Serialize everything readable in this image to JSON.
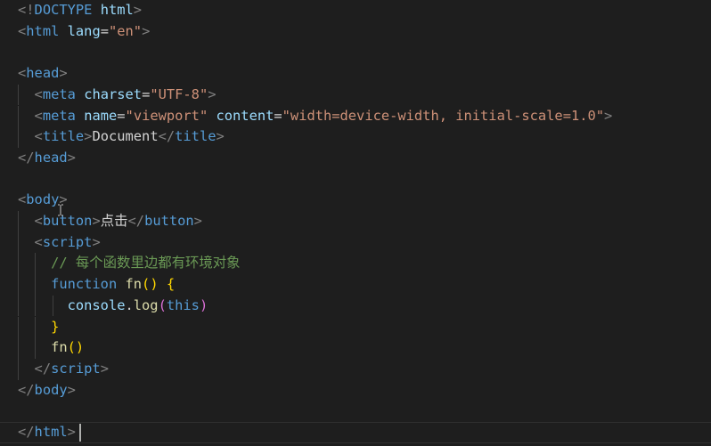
{
  "editor": {
    "lines": [
      [
        {
          "c": "t-punc",
          "t": "<!"
        },
        {
          "c": "t-tag",
          "t": "DOCTYPE"
        },
        {
          "c": "t-text",
          "t": " "
        },
        {
          "c": "t-attr",
          "t": "html"
        },
        {
          "c": "t-punc",
          "t": ">"
        }
      ],
      [
        {
          "c": "t-punc",
          "t": "<"
        },
        {
          "c": "t-tag",
          "t": "html"
        },
        {
          "c": "t-text",
          "t": " "
        },
        {
          "c": "t-attr",
          "t": "lang"
        },
        {
          "c": "t-text",
          "t": "="
        },
        {
          "c": "t-str",
          "t": "\"en\""
        },
        {
          "c": "t-punc",
          "t": ">"
        }
      ],
      [],
      [
        {
          "c": "t-punc",
          "t": "<"
        },
        {
          "c": "t-tag",
          "t": "head"
        },
        {
          "c": "t-punc",
          "t": ">"
        }
      ],
      [
        {
          "c": "t-text",
          "t": "  "
        },
        {
          "c": "t-punc",
          "t": "<"
        },
        {
          "c": "t-tag",
          "t": "meta"
        },
        {
          "c": "t-text",
          "t": " "
        },
        {
          "c": "t-attr",
          "t": "charset"
        },
        {
          "c": "t-text",
          "t": "="
        },
        {
          "c": "t-str",
          "t": "\"UTF-8\""
        },
        {
          "c": "t-punc",
          "t": ">"
        }
      ],
      [
        {
          "c": "t-text",
          "t": "  "
        },
        {
          "c": "t-punc",
          "t": "<"
        },
        {
          "c": "t-tag",
          "t": "meta"
        },
        {
          "c": "t-text",
          "t": " "
        },
        {
          "c": "t-attr",
          "t": "name"
        },
        {
          "c": "t-text",
          "t": "="
        },
        {
          "c": "t-str",
          "t": "\"viewport\""
        },
        {
          "c": "t-text",
          "t": " "
        },
        {
          "c": "t-attr",
          "t": "content"
        },
        {
          "c": "t-text",
          "t": "="
        },
        {
          "c": "t-str",
          "t": "\"width=device-width, initial-scale=1.0\""
        },
        {
          "c": "t-punc",
          "t": ">"
        }
      ],
      [
        {
          "c": "t-text",
          "t": "  "
        },
        {
          "c": "t-punc",
          "t": "<"
        },
        {
          "c": "t-tag",
          "t": "title"
        },
        {
          "c": "t-punc",
          "t": ">"
        },
        {
          "c": "t-text",
          "t": "Document"
        },
        {
          "c": "t-punc",
          "t": "</"
        },
        {
          "c": "t-tag",
          "t": "title"
        },
        {
          "c": "t-punc",
          "t": ">"
        }
      ],
      [
        {
          "c": "t-punc",
          "t": "</"
        },
        {
          "c": "t-tag",
          "t": "head"
        },
        {
          "c": "t-punc",
          "t": ">"
        }
      ],
      [],
      [
        {
          "c": "t-punc",
          "t": "<"
        },
        {
          "c": "t-tag",
          "t": "body"
        },
        {
          "c": "t-punc",
          "t": ">"
        }
      ],
      [
        {
          "c": "t-text",
          "t": "  "
        },
        {
          "c": "t-punc",
          "t": "<"
        },
        {
          "c": "t-tag",
          "t": "button"
        },
        {
          "c": "t-punc",
          "t": ">"
        },
        {
          "c": "t-text",
          "t": "点击"
        },
        {
          "c": "t-punc",
          "t": "</"
        },
        {
          "c": "t-tag",
          "t": "button"
        },
        {
          "c": "t-punc",
          "t": ">"
        }
      ],
      [
        {
          "c": "t-text",
          "t": "  "
        },
        {
          "c": "t-punc",
          "t": "<"
        },
        {
          "c": "t-tag",
          "t": "script"
        },
        {
          "c": "t-punc",
          "t": ">"
        }
      ],
      [
        {
          "c": "t-text",
          "t": "    "
        },
        {
          "c": "t-cmt",
          "t": "// 每个函数里边都有环境对象"
        }
      ],
      [
        {
          "c": "t-text",
          "t": "    "
        },
        {
          "c": "t-kw",
          "t": "function"
        },
        {
          "c": "t-text",
          "t": " "
        },
        {
          "c": "t-fn",
          "t": "fn"
        },
        {
          "c": "t-br1",
          "t": "()"
        },
        {
          "c": "t-text",
          "t": " "
        },
        {
          "c": "t-br1",
          "t": "{"
        }
      ],
      [
        {
          "c": "t-text",
          "t": "      "
        },
        {
          "c": "t-var",
          "t": "console"
        },
        {
          "c": "t-text",
          "t": "."
        },
        {
          "c": "t-fn",
          "t": "log"
        },
        {
          "c": "t-br2",
          "t": "("
        },
        {
          "c": "t-this",
          "t": "this"
        },
        {
          "c": "t-br2",
          "t": ")"
        }
      ],
      [
        {
          "c": "t-text",
          "t": "    "
        },
        {
          "c": "t-br1",
          "t": "}"
        }
      ],
      [
        {
          "c": "t-text",
          "t": "    "
        },
        {
          "c": "t-fn",
          "t": "fn"
        },
        {
          "c": "t-br1",
          "t": "()"
        }
      ],
      [
        {
          "c": "t-text",
          "t": "  "
        },
        {
          "c": "t-punc",
          "t": "</"
        },
        {
          "c": "t-tag",
          "t": "script"
        },
        {
          "c": "t-punc",
          "t": ">"
        }
      ],
      [
        {
          "c": "t-punc",
          "t": "</"
        },
        {
          "c": "t-tag",
          "t": "body"
        },
        {
          "c": "t-punc",
          "t": ">"
        }
      ],
      [],
      [
        {
          "c": "t-punc",
          "t": "</"
        },
        {
          "c": "t-tag",
          "t": "html"
        },
        {
          "c": "t-punc",
          "t": ">"
        }
      ]
    ],
    "indent_levels": [
      0,
      0,
      0,
      0,
      1,
      1,
      1,
      0,
      0,
      0,
      1,
      1,
      2,
      2,
      3,
      2,
      2,
      1,
      0,
      0,
      0
    ],
    "current_line": 20,
    "colors": {
      "background": "#1e1e1e",
      "tag": "#569cd6",
      "attribute": "#9cdcfe",
      "string": "#ce9178",
      "punctuation": "#808080",
      "comment": "#6a9955",
      "function": "#dcdcaa",
      "bracket_level_1": "#ffd700",
      "bracket_level_2": "#da70d6"
    }
  }
}
